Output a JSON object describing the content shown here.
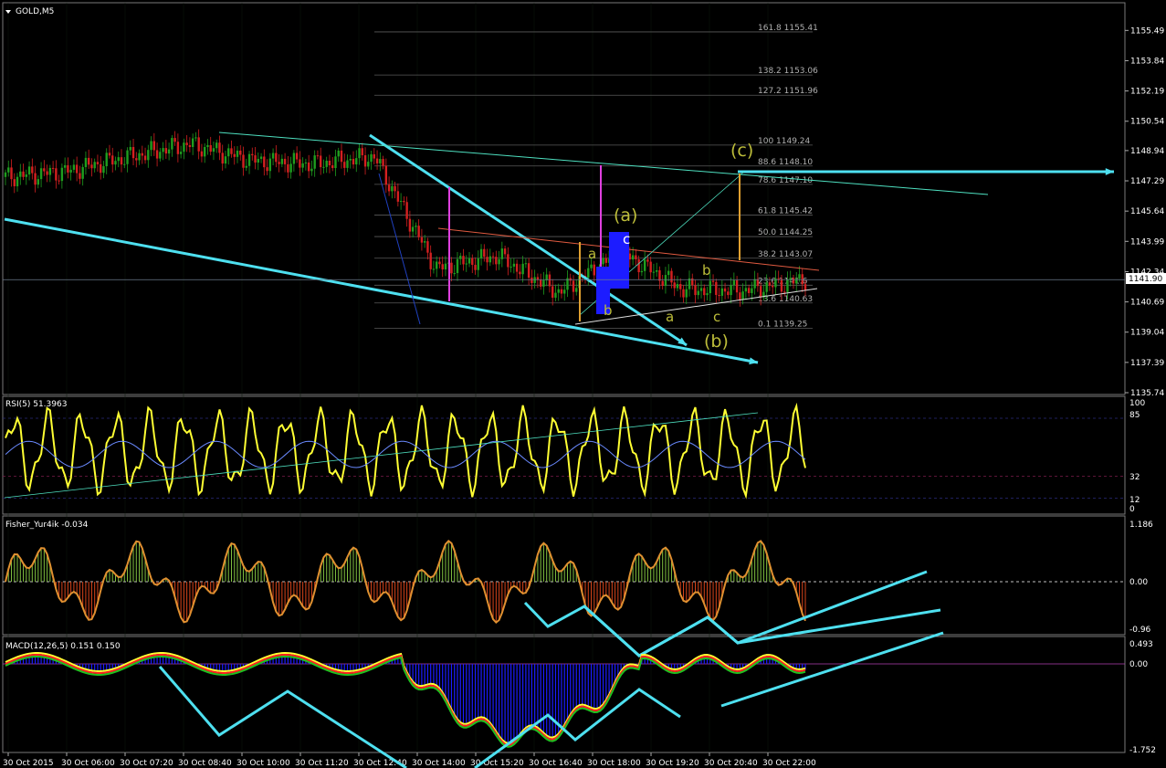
{
  "main_title": "GOLD,M5",
  "panels": {
    "rsi": {
      "title": "RSI(5) 51.3963",
      "levels": [
        "100",
        "85",
        "32",
        "12",
        "0"
      ]
    },
    "fisher": {
      "title": "Fisher_Yur4ik -0.034",
      "levels": [
        "1.186",
        "0.00",
        "-0.96"
      ]
    },
    "macd": {
      "title": "MACD(12,26,5) 0.151 0.150",
      "levels": [
        "0.493",
        "0.00",
        "-1.752"
      ]
    }
  },
  "price_axis": {
    "ticks": [
      "1155.49",
      "1153.84",
      "1152.19",
      "1150.54",
      "1148.94",
      "1147.29",
      "1145.64",
      "1143.99",
      "1142.34",
      "1140.69",
      "1139.04",
      "1137.39",
      "1135.74"
    ],
    "current_price": "1141.90"
  },
  "time_axis": {
    "ticks": [
      "30 Oct 2015",
      "30 Oct 06:00",
      "30 Oct 07:20",
      "30 Oct 08:40",
      "30 Oct 10:00",
      "30 Oct 11:20",
      "30 Oct 12:40",
      "30 Oct 14:00",
      "30 Oct 15:20",
      "30 Oct 16:40",
      "30 Oct 18:00",
      "30 Oct 19:20",
      "30 Oct 20:40",
      "30 Oct 22:00"
    ]
  },
  "fibonacci": [
    {
      "ratio": "161.8",
      "price": "1155.41"
    },
    {
      "ratio": "138.2",
      "price": "1153.06"
    },
    {
      "ratio": "127.2",
      "price": "1151.96"
    },
    {
      "ratio": "100",
      "price": "1149.24"
    },
    {
      "ratio": "88.6",
      "price": "1148.10"
    },
    {
      "ratio": "78.6",
      "price": "1147.10"
    },
    {
      "ratio": "61.8",
      "price": "1145.42"
    },
    {
      "ratio": "50.0",
      "price": "1144.25"
    },
    {
      "ratio": "38.2",
      "price": "1143.07"
    },
    {
      "ratio": "23.6",
      "price": "1141.6"
    },
    {
      "ratio": "13.6",
      "price": "1140.63"
    },
    {
      "ratio": "0.1",
      "price": "1139.25"
    }
  ],
  "wave_labels": {
    "big_a": "(a)",
    "big_b": "(b)",
    "big_c": "(c)",
    "a1": "a",
    "b1": "b",
    "c1": "c",
    "a2": "a",
    "b2": "b",
    "c2": "c"
  },
  "colors": {
    "background": "#000000",
    "grid": "#1e3a1e",
    "bull_candle": "#1f9e1f",
    "bear_candle": "#d42020",
    "trendline": "#4ee0f0",
    "wave_label": "#bdbd3a",
    "rsi_line": "#ffff33",
    "macd_hist": "#1c1cff",
    "fisher_pos": "#7fbf3f",
    "fisher_neg": "#d9441a"
  },
  "chart_data": {
    "type": "line",
    "title": "GOLD,M5",
    "xlabel": "",
    "ylabel": "",
    "ylim": [
      1135.74,
      1157.0
    ],
    "x": [
      "30 Oct 2015",
      "30 Oct 06:00",
      "30 Oct 07:20",
      "30 Oct 08:40",
      "30 Oct 10:00",
      "30 Oct 11:20",
      "30 Oct 12:40",
      "30 Oct 14:00",
      "30 Oct 15:20",
      "30 Oct 16:40",
      "30 Oct 18:00",
      "30 Oct 19:20",
      "30 Oct 20:40",
      "30 Oct 22:00"
    ],
    "series": [
      {
        "values": [
          1147.5,
          1147.8,
          1148.6,
          1149.3,
          1148.4,
          1148.2,
          1148.6,
          1142.5,
          1143.2,
          1141.2,
          1143.4,
          1141.4,
          1141.3,
          1141.9
        ]
      }
    ],
    "grid": true
  }
}
